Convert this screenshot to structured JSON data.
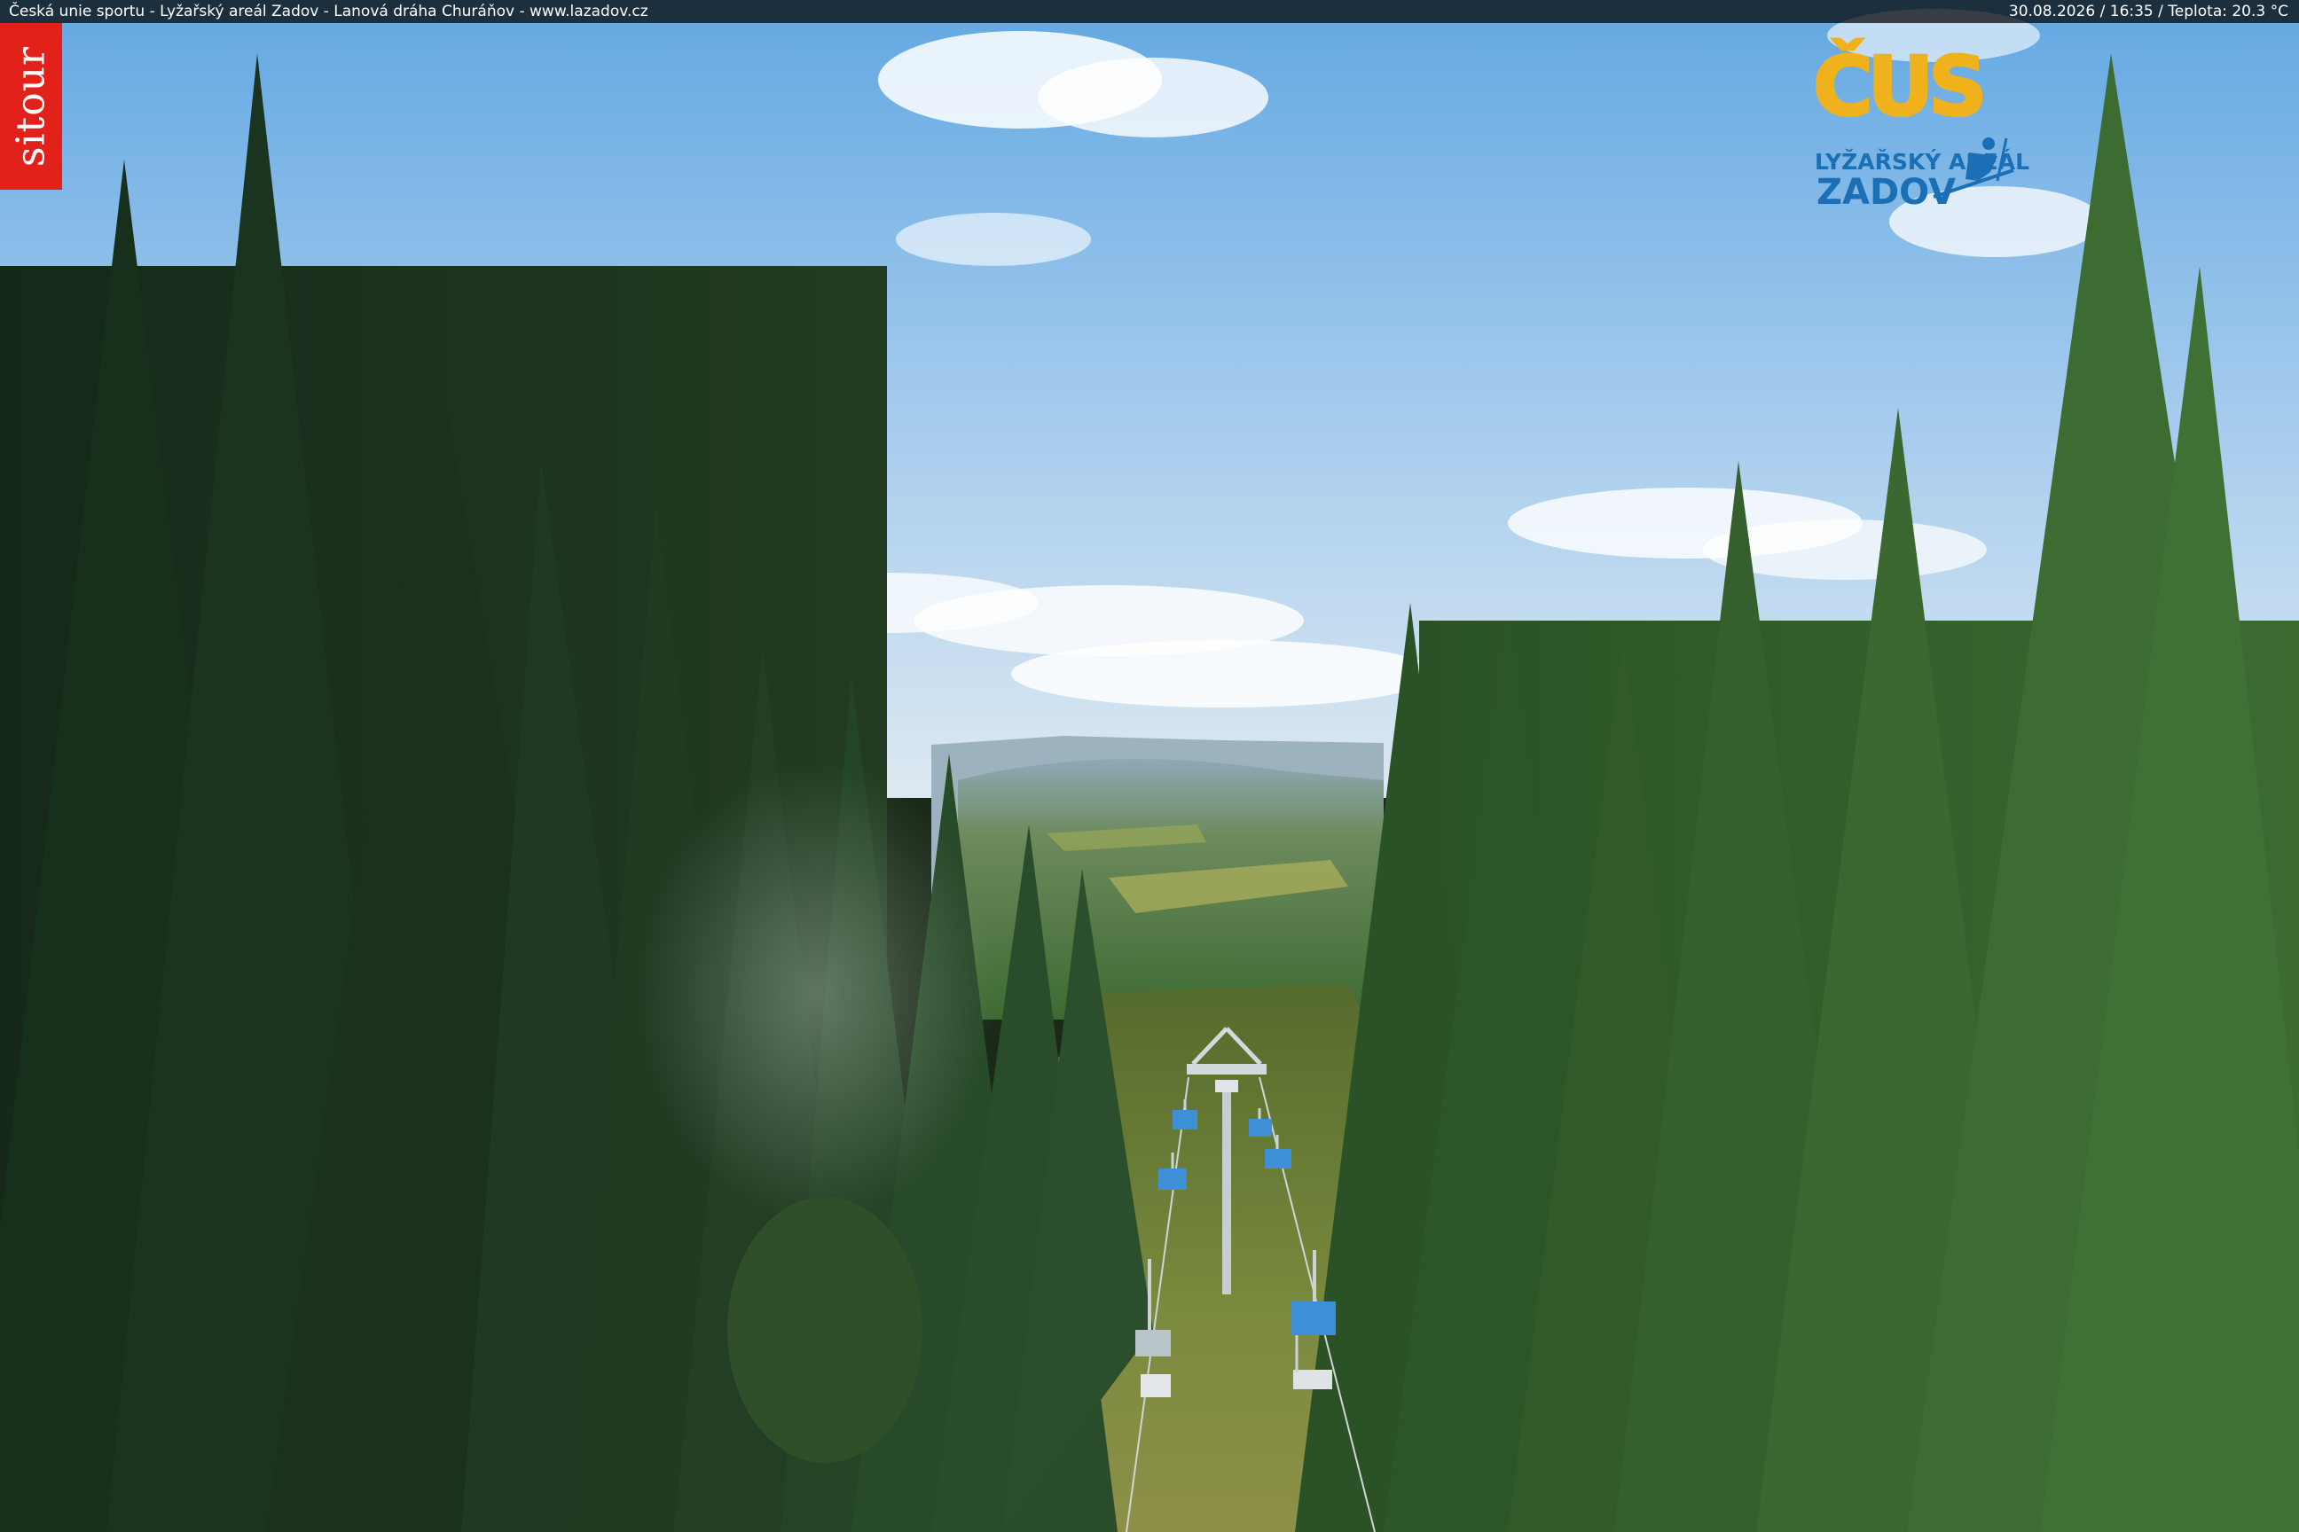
{
  "caption": {
    "left": "Česká unie sportu - Lyžařský areál Zadov - Lanová dráha Churáňov - www.lazadov.cz",
    "right": "30.08.2026 / 16:35 / Teplota: 20.3 °C"
  },
  "brand": {
    "sitour": "sitour",
    "logo_top": "ČUS",
    "logo_line1": "LYŽAŘSKÝ AREÁL",
    "logo_line2": "ZADOV"
  },
  "colors": {
    "sky_top": "#6aaee3",
    "sky_bottom": "#d6e8f3",
    "forest_dark": "#1d3520",
    "forest_mid": "#2f5a2d",
    "grass": "#7e8a3c",
    "sitour_red": "#e3211b",
    "logo_blue": "#1a6fb5",
    "logo_gold": "#f0b21c"
  }
}
